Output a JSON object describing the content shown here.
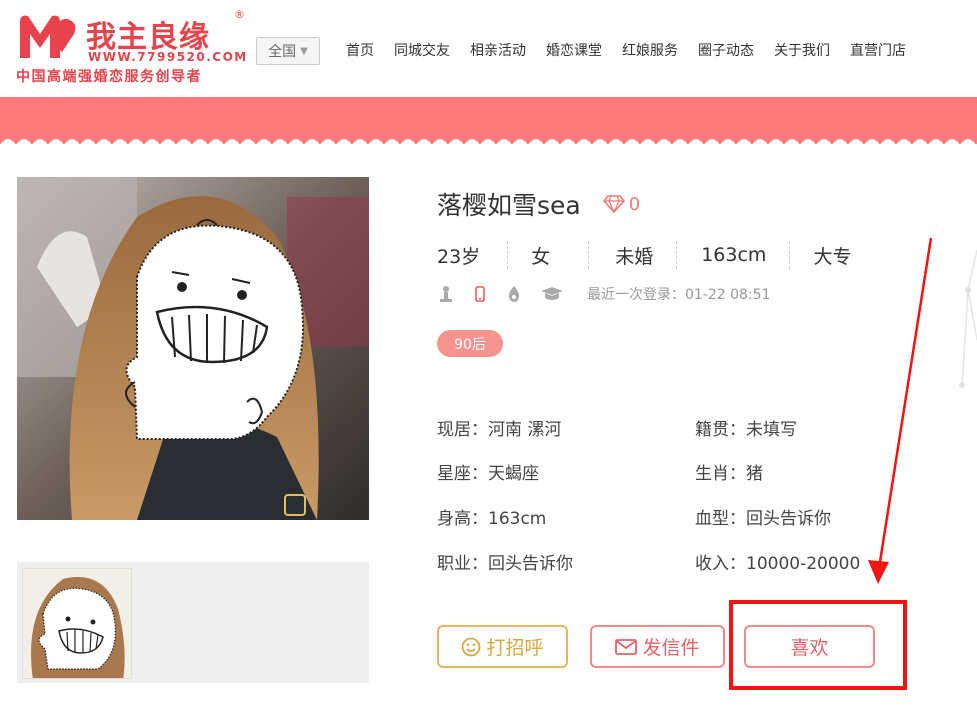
{
  "brand": {
    "name": "我主良缘",
    "registered": "®",
    "url": "WWW.7799520.COM",
    "slogan": "中国高端强婚恋服务创导者",
    "color": "#e8424a"
  },
  "region": {
    "label": "全国",
    "icon": "chevron-down-icon"
  },
  "nav": [
    "首页",
    "同城交友",
    "相亲活动",
    "婚恋课堂",
    "红娘服务",
    "圈子动态",
    "关于我们",
    "直营门店"
  ],
  "band_color": "#ff7a7a",
  "profile": {
    "name": "落樱如雪sea",
    "gem_count": "0",
    "stats": [
      "23岁",
      "女",
      "未婚",
      "163cm",
      "大专"
    ],
    "last_login": "最近一次登录：01-22 08:51",
    "tag": "90后",
    "details": {
      "residence": "现居：河南 漯河",
      "hometown": "籍贯：未填写",
      "zodiac": "星座：天蝎座",
      "chinese_zodiac": "生肖：猪",
      "height": "身高：163cm",
      "blood_type": "血型：回头告诉你",
      "occupation": "职业：回头告诉你",
      "income": "收入：10000-20000"
    }
  },
  "actions": {
    "greet": "打招呼",
    "mail": "发信件",
    "like": "喜欢"
  },
  "annotation": {
    "color": "#f21313"
  }
}
